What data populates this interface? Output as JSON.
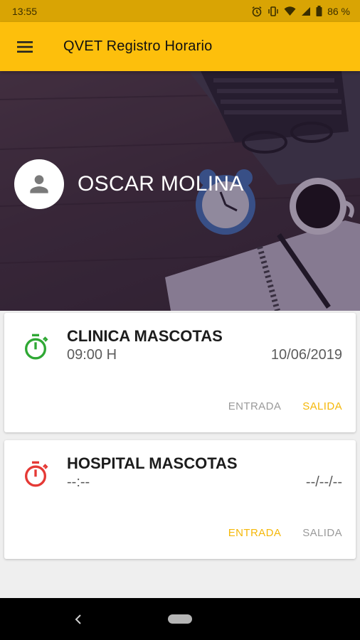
{
  "status_bar": {
    "time": "13:55",
    "battery": "86 %"
  },
  "app_bar": {
    "title": "QVET Registro Horario",
    "menu_icon": "menu-icon"
  },
  "profile": {
    "name": "OSCAR MOLINA",
    "avatar_icon": "person-icon"
  },
  "records": [
    {
      "place": "CLINICA MASCOTAS",
      "time": "09:00 H",
      "date": "10/06/2019",
      "icon_color": "#2fa834",
      "entrada_label": "ENTRADA",
      "salida_label": "SALIDA"
    },
    {
      "place": "HOSPITAL MASCOTAS",
      "time": "--:--",
      "date": "--/--/--",
      "icon_color": "#e53935",
      "entrada_label": "ENTRADA",
      "salida_label": "SALIDA"
    }
  ],
  "colors": {
    "accent": "#fdbf0c",
    "status_bar": "#d9a404",
    "action_enabled": "#f5b80a",
    "action_disabled": "#9a9a9a"
  }
}
